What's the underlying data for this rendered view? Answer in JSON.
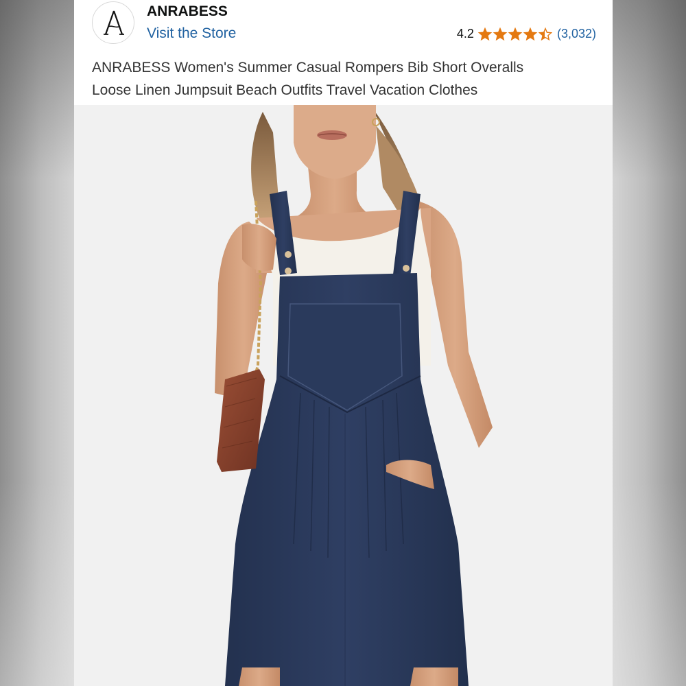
{
  "brand": {
    "logo_letter": "A",
    "name": "ANRABESS",
    "store_link": "Visit the Store"
  },
  "rating": {
    "value_text": "4.2",
    "value": 4.2,
    "max": 5,
    "count_text": "(3,032)",
    "star_color": "#e47911"
  },
  "product": {
    "title_line1": "ANRABESS Women's Summer Casual Rompers Bib Short Overalls",
    "title_line2": "Loose Linen Jumpsuit Beach Outfits Travel Vacation Clothes",
    "image_subject": "model wearing navy linen bib short overalls over white tank top, holding brown chain-strap shoulder bag"
  },
  "colors": {
    "link": "#2162a1",
    "text": "#0f1111",
    "garment": "#2b3a5c"
  }
}
